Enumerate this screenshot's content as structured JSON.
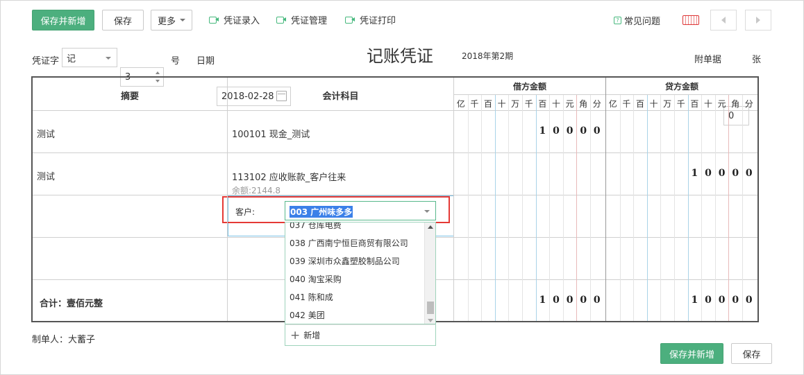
{
  "toolbar": {
    "save_new": "保存并新增",
    "save": "保存",
    "more": "更多",
    "voucher_entry": "凭证录入",
    "voucher_manage": "凭证管理",
    "voucher_print": "凭证打印",
    "faq": "常见问题",
    "faq_badge": "?"
  },
  "header": {
    "voucher_word_label": "凭证字",
    "voucher_word_value": "记",
    "number_value": "3",
    "number_suffix": "号",
    "date_label": "日期",
    "date_value": "2018-02-28",
    "title": "记账凭证",
    "period": "2018年第2期",
    "attach_label": "附单据",
    "attach_value": "0",
    "attach_unit": "张"
  },
  "table": {
    "col_summary": "摘要",
    "col_account": "会计科目",
    "col_debit": "借方金额",
    "col_credit": "贷方金额",
    "units": [
      "亿",
      "千",
      "百",
      "十",
      "万",
      "千",
      "百",
      "十",
      "元",
      "角",
      "分"
    ],
    "rows": [
      {
        "summary": "测试",
        "account": "100101 现金_测试",
        "debit": [
          "",
          "",
          "",
          "",
          "",
          "",
          "1",
          "0",
          "0",
          "0",
          "0"
        ],
        "credit": [
          "",
          "",
          "",
          "",
          "",
          "",
          "",
          "",
          "",
          "",
          ""
        ]
      },
      {
        "summary": "测试",
        "account": "113102 应收账款_客户往来",
        "balance": "余额:2144.8",
        "debit": [
          "",
          "",
          "",
          "",
          "",
          "",
          "",
          "",
          "",
          "",
          ""
        ],
        "credit": [
          "",
          "",
          "",
          "",
          "",
          "",
          "1",
          "0",
          "0",
          "0",
          "0"
        ]
      }
    ],
    "total_label": "合计：壹佰元整",
    "total_debit": [
      "",
      "",
      "",
      "",
      "",
      "",
      "1",
      "0",
      "0",
      "0",
      "0"
    ],
    "total_credit": [
      "",
      "",
      "",
      "",
      "",
      "",
      "1",
      "0",
      "0",
      "0",
      "0"
    ]
  },
  "aux": {
    "customer_label": "客户:",
    "customer_value": "003 广州味多多"
  },
  "dropdown": {
    "items": [
      "037 仓库电费",
      "038 广西南宁恒巨商贸有限公司",
      "039 深圳市众鑫塑胶制品公司",
      "040 淘宝采购",
      "041 陈和成",
      "042 美团"
    ],
    "add_new": "新增"
  },
  "footer": {
    "maker_label": "制单人：大蓄子",
    "save_new": "保存并新增",
    "save": "保存"
  },
  "colors": {
    "accent": "#4caf7e",
    "highlight_border": "#e53935",
    "selection": "#3b80e8"
  }
}
